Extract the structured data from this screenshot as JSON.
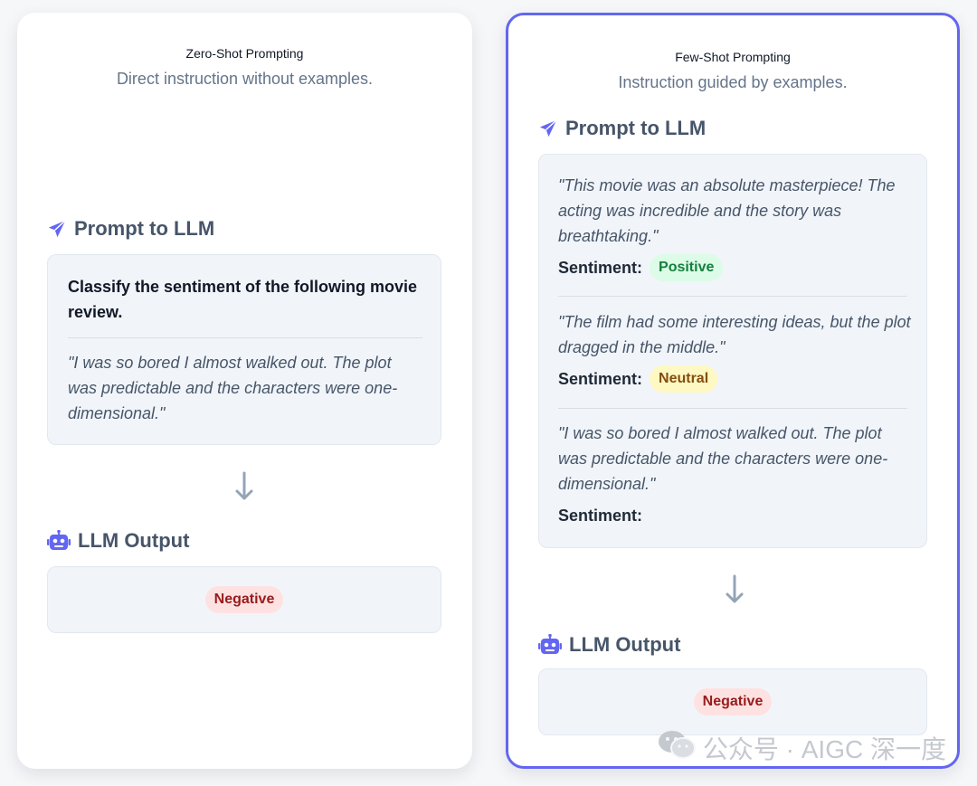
{
  "zero_shot": {
    "title": "Zero-Shot Prompting",
    "subtitle": "Direct instruction without examples.",
    "prompt_heading": "Prompt to LLM",
    "instruction": "Classify the sentiment of the following movie review.",
    "review": "\"I was so bored I almost walked out. The plot was predictable and the characters were one-dimensional.\"",
    "output_heading": "LLM Output",
    "output_label": "Negative"
  },
  "few_shot": {
    "title": "Few-Shot Prompting",
    "subtitle": "Instruction guided by examples.",
    "prompt_heading": "Prompt to LLM",
    "sentiment_label": "Sentiment:",
    "examples": [
      {
        "review": "\"This movie was an absolute masterpiece! The acting was incredible and the story was breathtaking.\"",
        "sentiment": "Positive"
      },
      {
        "review": "\"The film had some interesting ideas, but the plot dragged in the middle.\"",
        "sentiment": "Neutral"
      },
      {
        "review": "\"I was so bored I almost walked out. The plot was predictable and the characters were one-dimensional.\"",
        "sentiment": ""
      }
    ],
    "output_heading": "LLM Output",
    "output_label": "Negative"
  },
  "icons": {
    "prompt": "paper-plane-icon",
    "output": "robot-icon",
    "flow": "arrow-down-icon",
    "watermark": "wechat-icon"
  },
  "colors": {
    "accent": "#6366f1",
    "positive_bg": "#dcfce7",
    "positive_fg": "#15803d",
    "neutral_bg": "#fef9c3",
    "neutral_fg": "#854d0e",
    "negative_bg": "#fee2e2",
    "negative_fg": "#991b1b"
  },
  "watermark": {
    "text": "公众号 · AIGC 深一度"
  }
}
